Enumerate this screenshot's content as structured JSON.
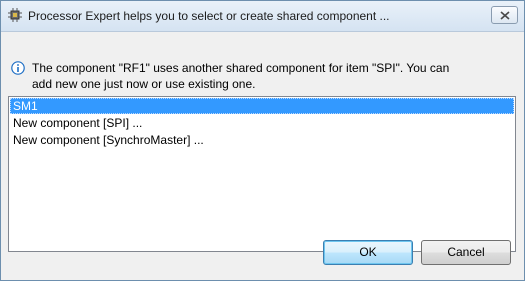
{
  "window": {
    "title": "Processor Expert helps you to select or create shared component ..."
  },
  "message": {
    "text": "The component \"RF1\" uses another shared component for item \"SPI\". You can add new one just now or use existing one."
  },
  "list": {
    "items": [
      {
        "label": "SM1",
        "selected": true
      },
      {
        "label": "New component [SPI] ...",
        "selected": false
      },
      {
        "label": "New component [SynchroMaster] ...",
        "selected": false
      }
    ]
  },
  "buttons": {
    "ok_label": "OK",
    "cancel_label": "Cancel"
  },
  "icons": {
    "title": "processor-chip-icon",
    "message": "info-icon",
    "close": "close-icon"
  },
  "colors": {
    "selection": "#3399ff",
    "info_icon": "#1f6fc5"
  }
}
